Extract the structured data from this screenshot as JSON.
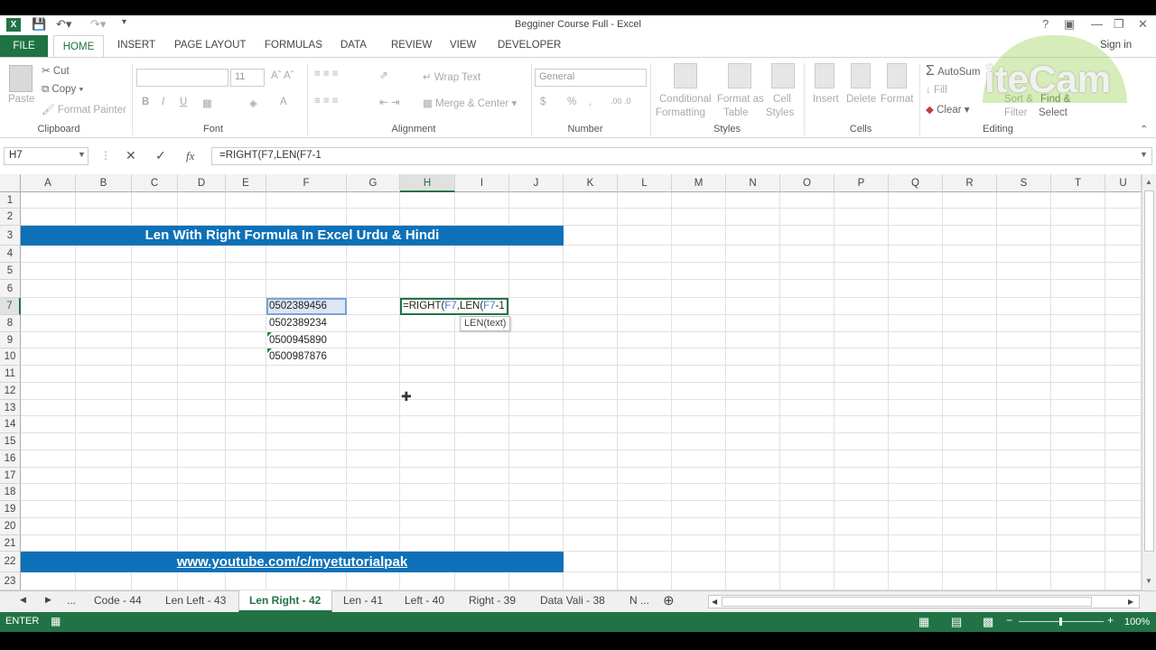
{
  "window": {
    "title": "Begginer Course Full - Excel",
    "help": "?",
    "sign_in": "Sign in"
  },
  "ribbon_tabs": [
    "FILE",
    "HOME",
    "INSERT",
    "PAGE LAYOUT",
    "FORMULAS",
    "DATA",
    "REVIEW",
    "VIEW",
    "DEVELOPER"
  ],
  "clipboard": {
    "paste": "Paste",
    "cut": "Cut",
    "copy": "Copy",
    "format_painter": "Format Painter",
    "label": "Clipboard"
  },
  "font": {
    "size": "11",
    "bold": "B",
    "italic": "I",
    "underline": "U",
    "label": "Font"
  },
  "alignment": {
    "wrap": "Wrap Text",
    "merge": "Merge & Center",
    "label": "Alignment"
  },
  "number": {
    "format": "General",
    "currency": "$",
    "percent": "%",
    "label": "Number"
  },
  "styles": {
    "conditional": "Conditional",
    "conditional2": "Formatting",
    "format_as": "Format as",
    "format_as2": "Table",
    "cell": "Cell",
    "cell2": "Styles",
    "label": "Styles"
  },
  "cells": {
    "insert": "Insert",
    "delete": "Delete",
    "format": "Format",
    "label": "Cells"
  },
  "editing": {
    "autosum": "AutoSum",
    "fill": "Fill",
    "clear": "Clear",
    "sort": "Sort &",
    "sort2": "Filter",
    "find": "Find &",
    "find2": "Select",
    "label": "Editing"
  },
  "watermark": "iteCam",
  "formula_bar": {
    "name_box": "H7",
    "fx": "fx",
    "formula": "=RIGHT(F7,LEN(F7-1"
  },
  "columns": [
    "A",
    "B",
    "C",
    "D",
    "E",
    "F",
    "G",
    "H",
    "I",
    "J",
    "K",
    "L",
    "M",
    "N",
    "O",
    "P",
    "Q",
    "R",
    "S",
    "T",
    "U"
  ],
  "rows": [
    "1",
    "2",
    "3",
    "4",
    "5",
    "6",
    "7",
    "8",
    "9",
    "10",
    "11",
    "12",
    "13",
    "14",
    "15",
    "16",
    "17",
    "18",
    "19",
    "20",
    "21",
    "22",
    "23"
  ],
  "banner_title": "Len With Right Formula In Excel Urdu & Hindi",
  "banner_link": "www.youtube.com/c/myetutorialpak",
  "cells_f": [
    "0502389456",
    "0502389234",
    "0500945890",
    "0500987876"
  ],
  "edit_cell": {
    "a": "=RIGHT(",
    "b": "F7",
    "c": ",LEN(",
    "d": "F7",
    "e": "-1"
  },
  "tooltip": "LEN(text)",
  "sheet_tabs": [
    "...",
    "Code - 44",
    "Len Left - 43",
    "Len Right - 42",
    "Len - 41",
    "Left - 40",
    "Right - 39",
    "Data Vali - 38",
    "N ..."
  ],
  "status": {
    "mode": "ENTER",
    "zoom": "100%"
  },
  "colors": {
    "excel_green": "#217346",
    "banner_blue": "#0e71b8"
  }
}
